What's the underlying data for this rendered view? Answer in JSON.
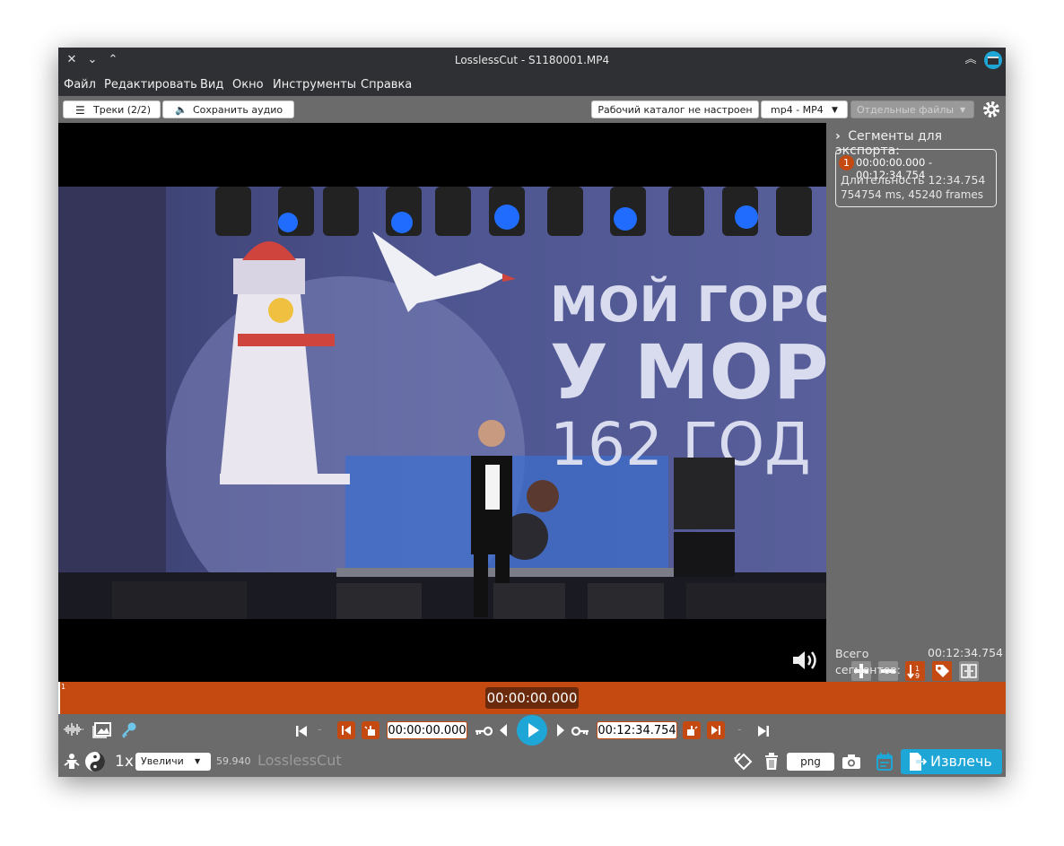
{
  "window": {
    "title": "LosslessCut - S1180001.MP4"
  },
  "menu": [
    "Файл",
    "Редактировать",
    "Вид",
    "Окно",
    "Инструменты",
    "Справка"
  ],
  "toolbar": {
    "tracks_label": "Треки (2/2)",
    "save_audio_label": "Сохранить аудио",
    "workdir_label": "Рабочий каталог не настроен",
    "format_label": "mp4 - MP4",
    "output_mode_label": "Отдельные файлы"
  },
  "video": {
    "banner_line1": "МОЙ ГОРО",
    "banner_line2": "У МОР",
    "banner_line3": "162 ГОД"
  },
  "sidebar": {
    "header": "Сегменты для экспорта:",
    "segment": {
      "index": "1",
      "range": "00:00:00.000 - 00:12:34.754",
      "duration": "Длительность 12:34.754",
      "details": "754754 ms, 45240 frames"
    },
    "total_label": "Всего сегментов:",
    "total_value": "00:12:34.754"
  },
  "timeline": {
    "segment_marker": "1",
    "current_time": "00:00:00.000"
  },
  "controls": {
    "start_time": "00:00:00.000",
    "end_time": "00:12:34.754",
    "dash_left": "-",
    "dash_right": "-",
    "speed": "1x",
    "zoom_label": "Увеличи",
    "fps": "59.940",
    "app_name": "LosslessCut",
    "screenshot_format": "png",
    "export_label": "Извлечь"
  },
  "colors": {
    "accent_orange": "#c54a12",
    "accent_blue": "#1ea7d6",
    "panel_gray": "#6b6b6b",
    "titlebar": "#2f3033"
  }
}
